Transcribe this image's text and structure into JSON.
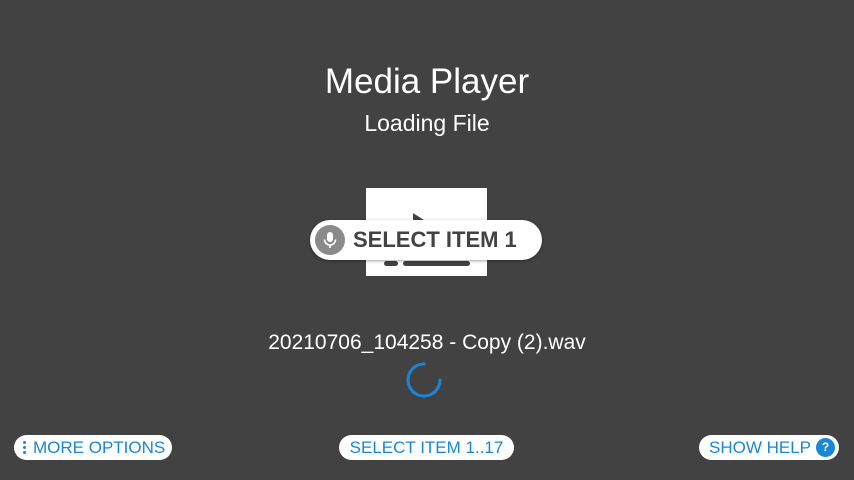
{
  "header": {
    "title": "Media Player",
    "subtitle": "Loading File"
  },
  "voice_command": {
    "label": "SELECT ITEM 1",
    "icon": "microphone-icon"
  },
  "media": {
    "thumbnail_icon": "play-icon",
    "filename": "20210706_104258 - Copy (2).wav",
    "status_icon": "loading-spinner-icon"
  },
  "footer": {
    "more_options_label": "MORE OPTIONS",
    "more_options_icon": "kebab-menu-icon",
    "select_items_label": "SELECT ITEM 1..17",
    "show_help_label": "SHOW HELP",
    "help_icon_glyph": "?"
  },
  "colors": {
    "background": "#424242",
    "accent": "#1a86d6",
    "text": "#ffffff"
  }
}
